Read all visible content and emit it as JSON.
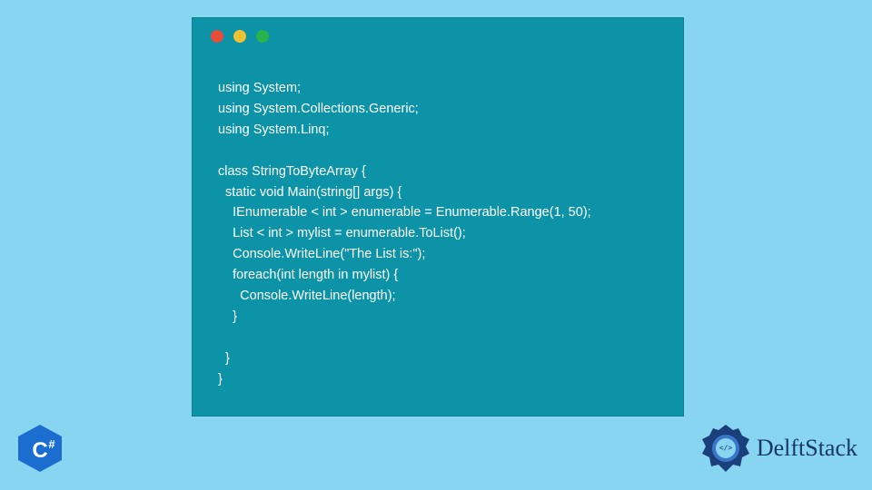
{
  "window": {
    "dots": [
      "red",
      "yellow",
      "green"
    ]
  },
  "code": {
    "lines": [
      "using System;",
      "using System.Collections.Generic;",
      "using System.Linq;",
      "",
      "class StringToByteArray {",
      "  static void Main(string[] args) {",
      "    IEnumerable < int > enumerable = Enumerable.Range(1, 50);",
      "    List < int > mylist = enumerable.ToList();",
      "    Console.WriteLine(\"The List is:\");",
      "    foreach(int length in mylist) {",
      "      Console.WriteLine(length);",
      "    }",
      "",
      "  }",
      "}"
    ]
  },
  "logos": {
    "csharp_label": "C#",
    "delft_label": "DelftStack"
  },
  "colors": {
    "page_bg": "#87d5f0",
    "window_bg": "#0c93a8",
    "code_text": "#ffffff",
    "csharp_hex": "#1c6dd0",
    "delft_text": "#17376a"
  }
}
